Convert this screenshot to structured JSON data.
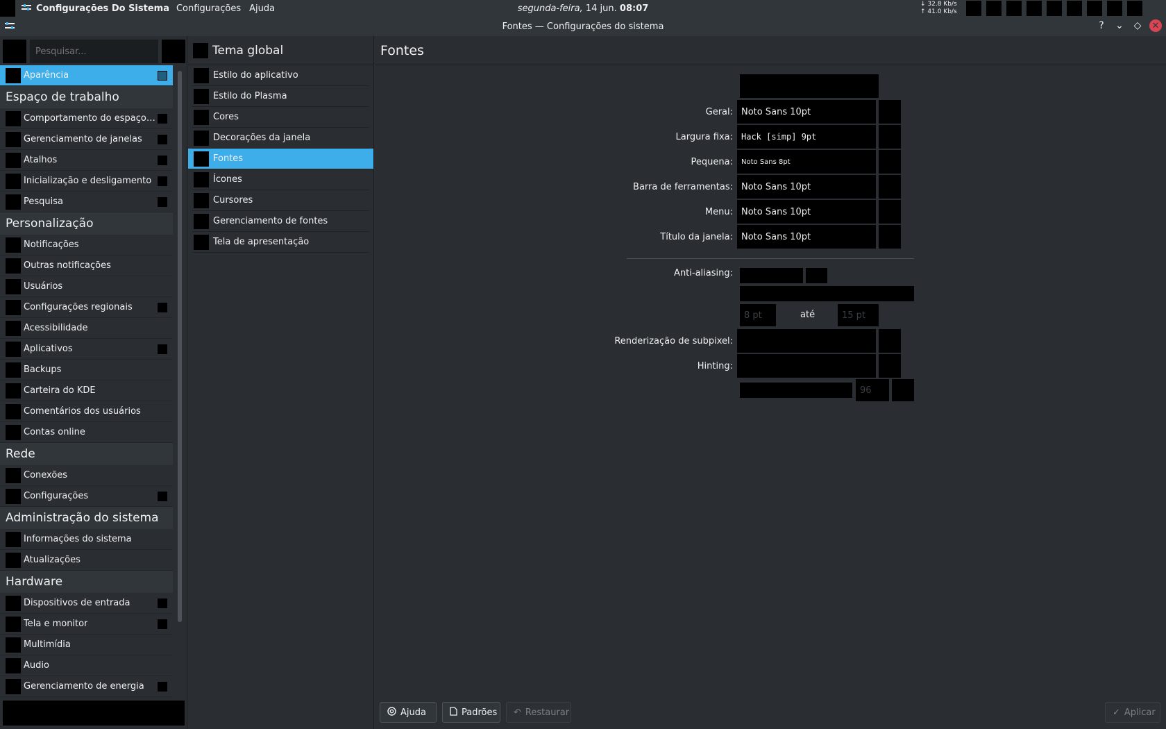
{
  "topbar": {
    "app_name": "Configurações Do Sistema",
    "menus": [
      "Configurações",
      "Ajuda"
    ],
    "clock": {
      "date": "segunda-feira,",
      "day": "14 jun.",
      "time": "08:07"
    },
    "net": {
      "down": "32.8 Kb/s",
      "up": "41.0 Kb/s"
    }
  },
  "titlebar": {
    "title": "Fontes — Configurações do sistema",
    "help_glyph": "?",
    "minimize_glyph": "⌄",
    "maximize_glyph": "◇",
    "close_glyph": "✕"
  },
  "sidebar": {
    "search_placeholder": "Pesquisar...",
    "sections": [
      {
        "type": "item",
        "label": "Aparência",
        "selected": true,
        "arrow": true
      },
      {
        "type": "header",
        "label": "Espaço de trabalho"
      },
      {
        "type": "item",
        "label": "Comportamento do espaço ...",
        "arrow": true
      },
      {
        "type": "item",
        "label": "Gerenciamento de janelas",
        "arrow": true
      },
      {
        "type": "item",
        "label": "Atalhos",
        "arrow": true
      },
      {
        "type": "item",
        "label": "Inicialização e desligamento",
        "arrow": true
      },
      {
        "type": "item",
        "label": "Pesquisa",
        "arrow": true
      },
      {
        "type": "header",
        "label": "Personalização"
      },
      {
        "type": "item",
        "label": "Notificações"
      },
      {
        "type": "item",
        "label": "Outras notificações"
      },
      {
        "type": "item",
        "label": "Usuários"
      },
      {
        "type": "item",
        "label": "Configurações regionais",
        "arrow": true
      },
      {
        "type": "item",
        "label": "Acessibilidade"
      },
      {
        "type": "item",
        "label": "Aplicativos",
        "arrow": true
      },
      {
        "type": "item",
        "label": "Backups"
      },
      {
        "type": "item",
        "label": "Carteira do KDE"
      },
      {
        "type": "item",
        "label": "Comentários dos usuários"
      },
      {
        "type": "item",
        "label": "Contas online"
      },
      {
        "type": "header",
        "label": "Rede"
      },
      {
        "type": "item",
        "label": "Conexões"
      },
      {
        "type": "item",
        "label": "Configurações",
        "arrow": true
      },
      {
        "type": "header",
        "label": "Administração do sistema"
      },
      {
        "type": "item",
        "label": "Informações do sistema"
      },
      {
        "type": "item",
        "label": "Atualizações"
      },
      {
        "type": "header",
        "label": "Hardware"
      },
      {
        "type": "item",
        "label": "Dispositivos de entrada",
        "arrow": true
      },
      {
        "type": "item",
        "label": "Tela e monitor",
        "arrow": true
      },
      {
        "type": "item",
        "label": "Multimídia"
      },
      {
        "type": "item",
        "label": "Áudio"
      },
      {
        "type": "item",
        "label": "Gerenciamento de energia",
        "arrow": true
      }
    ]
  },
  "middle": {
    "header": "Tema global",
    "items": [
      {
        "label": "Estilo do aplicativo"
      },
      {
        "label": "Estilo do Plasma"
      },
      {
        "label": "Cores"
      },
      {
        "label": "Decorações da janela"
      },
      {
        "label": "Fontes",
        "selected": true
      },
      {
        "label": "Ícones"
      },
      {
        "label": "Cursores"
      },
      {
        "label": "Gerenciamento de fontes"
      },
      {
        "label": "Tela de apresentação"
      }
    ]
  },
  "content": {
    "title": "Fontes",
    "fonts": {
      "geral_label": "Geral:",
      "geral_value": "Noto Sans 10pt",
      "fixa_label": "Largura fixa:",
      "fixa_value": "Hack [simp] 9pt",
      "pequena_label": "Pequena:",
      "pequena_value": "Noto Sans 8pt",
      "barra_label": "Barra de ferramentas:",
      "barra_value": "Noto Sans 10pt",
      "menu_label": "Menu:",
      "menu_value": "Noto Sans 10pt",
      "titulo_label": "Título da janela:",
      "titulo_value": "Noto Sans 10pt"
    },
    "aa_label": "Anti-aliasing:",
    "range_from": "8 pt",
    "range_sep": "até",
    "range_to": "15 pt",
    "subpixel_label": "Renderização de subpixel:",
    "hinting_label": "Hinting:",
    "dpi_value": "96"
  },
  "footer": {
    "help": "Ajuda",
    "defaults": "Padrões",
    "reset": "Restaurar",
    "apply": "Aplicar"
  }
}
